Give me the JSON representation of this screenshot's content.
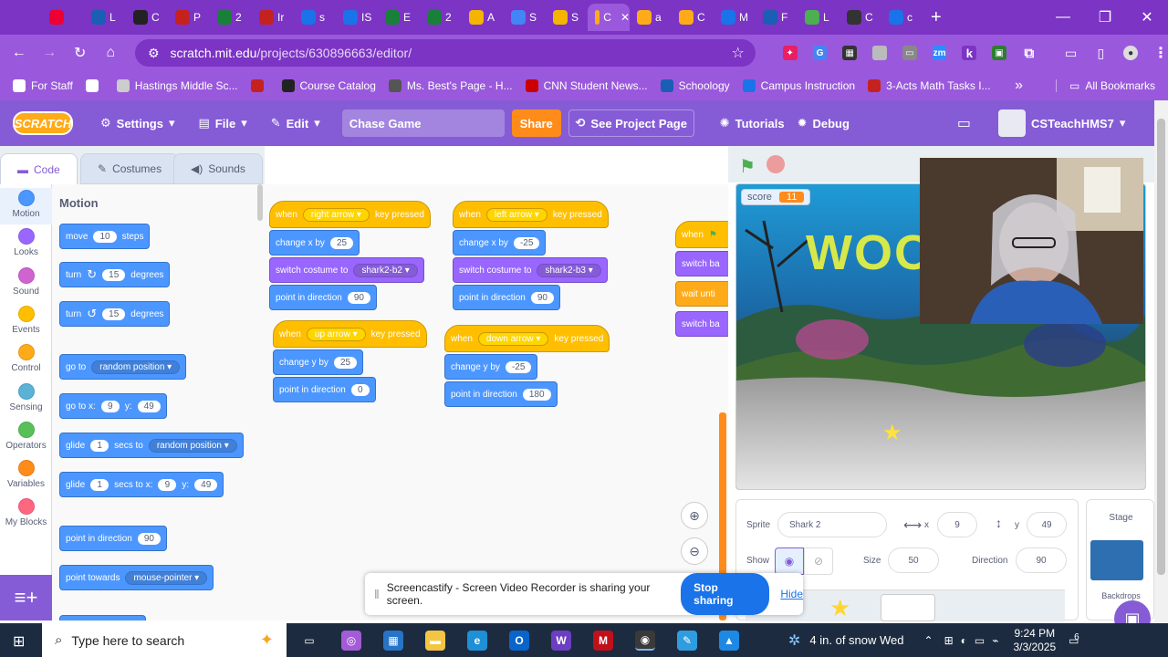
{
  "browser": {
    "tabs": [
      {
        "label": "",
        "icon": "dropdown-icon",
        "color": "#7b34c4"
      },
      {
        "label": "",
        "icon": "record-icon",
        "color": "#e03"
      },
      {
        "label": "L",
        "icon": "globe-icon",
        "color": "#1a5fb4"
      },
      {
        "label": "C",
        "icon": "grid-icon",
        "color": "#222"
      },
      {
        "label": "P",
        "icon": "gmail-icon",
        "color": "#c5221f"
      },
      {
        "label": "2",
        "icon": "drive-icon",
        "color": "#188038"
      },
      {
        "label": "Ir",
        "icon": "gmail-icon",
        "color": "#c5221f"
      },
      {
        "label": "s",
        "icon": "gear-icon",
        "color": "#1a73e8"
      },
      {
        "label": "IS",
        "icon": "doc-icon",
        "color": "#1a73e8"
      },
      {
        "label": "E",
        "icon": "drive-icon",
        "color": "#188038"
      },
      {
        "label": "2",
        "icon": "plus-icon",
        "color": "#188038"
      },
      {
        "label": "A",
        "icon": "slides-icon",
        "color": "#f4b400"
      },
      {
        "label": "S",
        "icon": "docs-icon",
        "color": "#4285f4"
      },
      {
        "label": "S",
        "icon": "slides-icon",
        "color": "#f4b400"
      },
      {
        "label": "C",
        "icon": "scratch-icon",
        "color": "#ffab19"
      },
      {
        "label": "a",
        "icon": "scratch-icon",
        "color": "#ffab19"
      },
      {
        "label": "C",
        "icon": "scratch-icon",
        "color": "#ffab19"
      },
      {
        "label": "M",
        "icon": "p-icon",
        "color": "#1a73e8"
      },
      {
        "label": "F",
        "icon": "globe-icon",
        "color": "#1a5fb4"
      },
      {
        "label": "L",
        "icon": "circle-icon",
        "color": "#4caf50"
      },
      {
        "label": "C",
        "icon": "circle-icon",
        "color": "#333"
      },
      {
        "label": "c",
        "icon": "p-icon",
        "color": "#1a73e8"
      }
    ],
    "active_tab_index": 14,
    "url_host": "scratch.mit.edu",
    "url_path": "/projects/630896663/editor/",
    "bookmarks": [
      {
        "label": "For Staff",
        "color": "#fff"
      },
      {
        "label": "",
        "color": "#fff"
      },
      {
        "label": "Hastings Middle Sc...",
        "color": "#ccc"
      },
      {
        "label": "",
        "color": "#c5221f"
      },
      {
        "label": "Course Catalog",
        "color": "#222"
      },
      {
        "label": "Ms. Best's Page - H...",
        "color": "#555"
      },
      {
        "label": "CNN Student News...",
        "color": "#cc0000"
      },
      {
        "label": "Schoology",
        "color": "#1a5fb4"
      },
      {
        "label": "Campus Instruction",
        "color": "#1a73e8"
      },
      {
        "label": "3-Acts Math Tasks I...",
        "color": "#c5221f"
      }
    ],
    "bookmarks_more": "»",
    "all_bookmarks": "All Bookmarks"
  },
  "scratch": {
    "logo": "SCRATCH",
    "menu": {
      "settings": "Settings",
      "file": "File",
      "edit": "Edit",
      "project_title": "Chase Game",
      "share": "Share",
      "see_project_page": "See Project Page",
      "tutorials": "Tutorials",
      "debug": "Debug",
      "username": "CSTeachHMS7"
    },
    "editor_tabs": {
      "code": "Code",
      "costumes": "Costumes",
      "sounds": "Sounds"
    },
    "categories": [
      {
        "label": "Motion",
        "color": "#4c97ff"
      },
      {
        "label": "Looks",
        "color": "#9966ff"
      },
      {
        "label": "Sound",
        "color": "#cf63cf"
      },
      {
        "label": "Events",
        "color": "#ffbf00"
      },
      {
        "label": "Control",
        "color": "#ffab19"
      },
      {
        "label": "Sensing",
        "color": "#5cb1d6"
      },
      {
        "label": "Operators",
        "color": "#59c059"
      },
      {
        "label": "Variables",
        "color": "#ff8c1a"
      },
      {
        "label": "My Blocks",
        "color": "#ff6680"
      }
    ],
    "palette": {
      "title": "Motion",
      "move": {
        "a": "move",
        "v": "10",
        "b": "steps"
      },
      "turn_right": {
        "a": "turn",
        "v": "15",
        "b": "degrees"
      },
      "turn_left": {
        "a": "turn",
        "v": "15",
        "b": "degrees"
      },
      "goto": {
        "a": "go to",
        "d": "random position"
      },
      "gotoxy": {
        "a": "go to x:",
        "x": "9",
        "b": "y:",
        "y": "49"
      },
      "glide": {
        "a": "glide",
        "v": "1",
        "b": "secs to",
        "d": "random position"
      },
      "glidexy": {
        "a": "glide",
        "v": "1",
        "b": "secs to x:",
        "x": "9",
        "c": "y:",
        "y": "49"
      },
      "pointdir": {
        "a": "point in direction",
        "v": "90"
      },
      "pointtowards": {
        "a": "point towards",
        "d": "mouse-pointer"
      }
    },
    "scripts": {
      "right": {
        "when": "when",
        "key": "right arrow",
        "pressed": "key pressed",
        "b1": "change x by",
        "v1": "25",
        "b2": "switch costume to",
        "v2": "shark2-b2",
        "b3": "point in direction",
        "v3": "90"
      },
      "left": {
        "when": "when",
        "key": "left arrow",
        "pressed": "key pressed",
        "b1": "change x by",
        "v1": "-25",
        "b2": "switch costume to",
        "v2": "shark2-b3",
        "b3": "point in direction",
        "v3": "90"
      },
      "up": {
        "when": "when",
        "key": "up arrow",
        "pressed": "key pressed",
        "b1": "change y by",
        "v1": "25",
        "b2": "point in direction",
        "v2": "0"
      },
      "down": {
        "when": "when",
        "key": "down arrow",
        "pressed": "key pressed",
        "b1": "change y by",
        "v1": "-25",
        "b2": "point in direction",
        "v2": "180"
      },
      "flag": {
        "when": "when",
        "b1": "switch ba",
        "b2": "wait unti",
        "b3": "switch ba"
      }
    },
    "stage": {
      "variable_name": "score",
      "variable_value": "11",
      "text": "WOO"
    },
    "sprite_info": {
      "sprite_label": "Sprite",
      "sprite_name": "Shark 2",
      "x_label": "x",
      "x": "9",
      "y_label": "y",
      "y": "49",
      "show_label": "Show",
      "size_label": "Size",
      "size": "50",
      "direction_label": "Direction",
      "direction": "90"
    },
    "stage_panel": {
      "title": "Stage",
      "backdrops_label": "Backdrops"
    }
  },
  "screencastify": {
    "message": "Screencastify - Screen Video Recorder is sharing your screen.",
    "stop": "Stop sharing",
    "hide": "Hide"
  },
  "taskbar": {
    "search_placeholder": "Type here to search",
    "weather": "4 in. of snow Wed",
    "time": "9:24 PM",
    "date": "3/3/2025",
    "notifications": "6"
  }
}
